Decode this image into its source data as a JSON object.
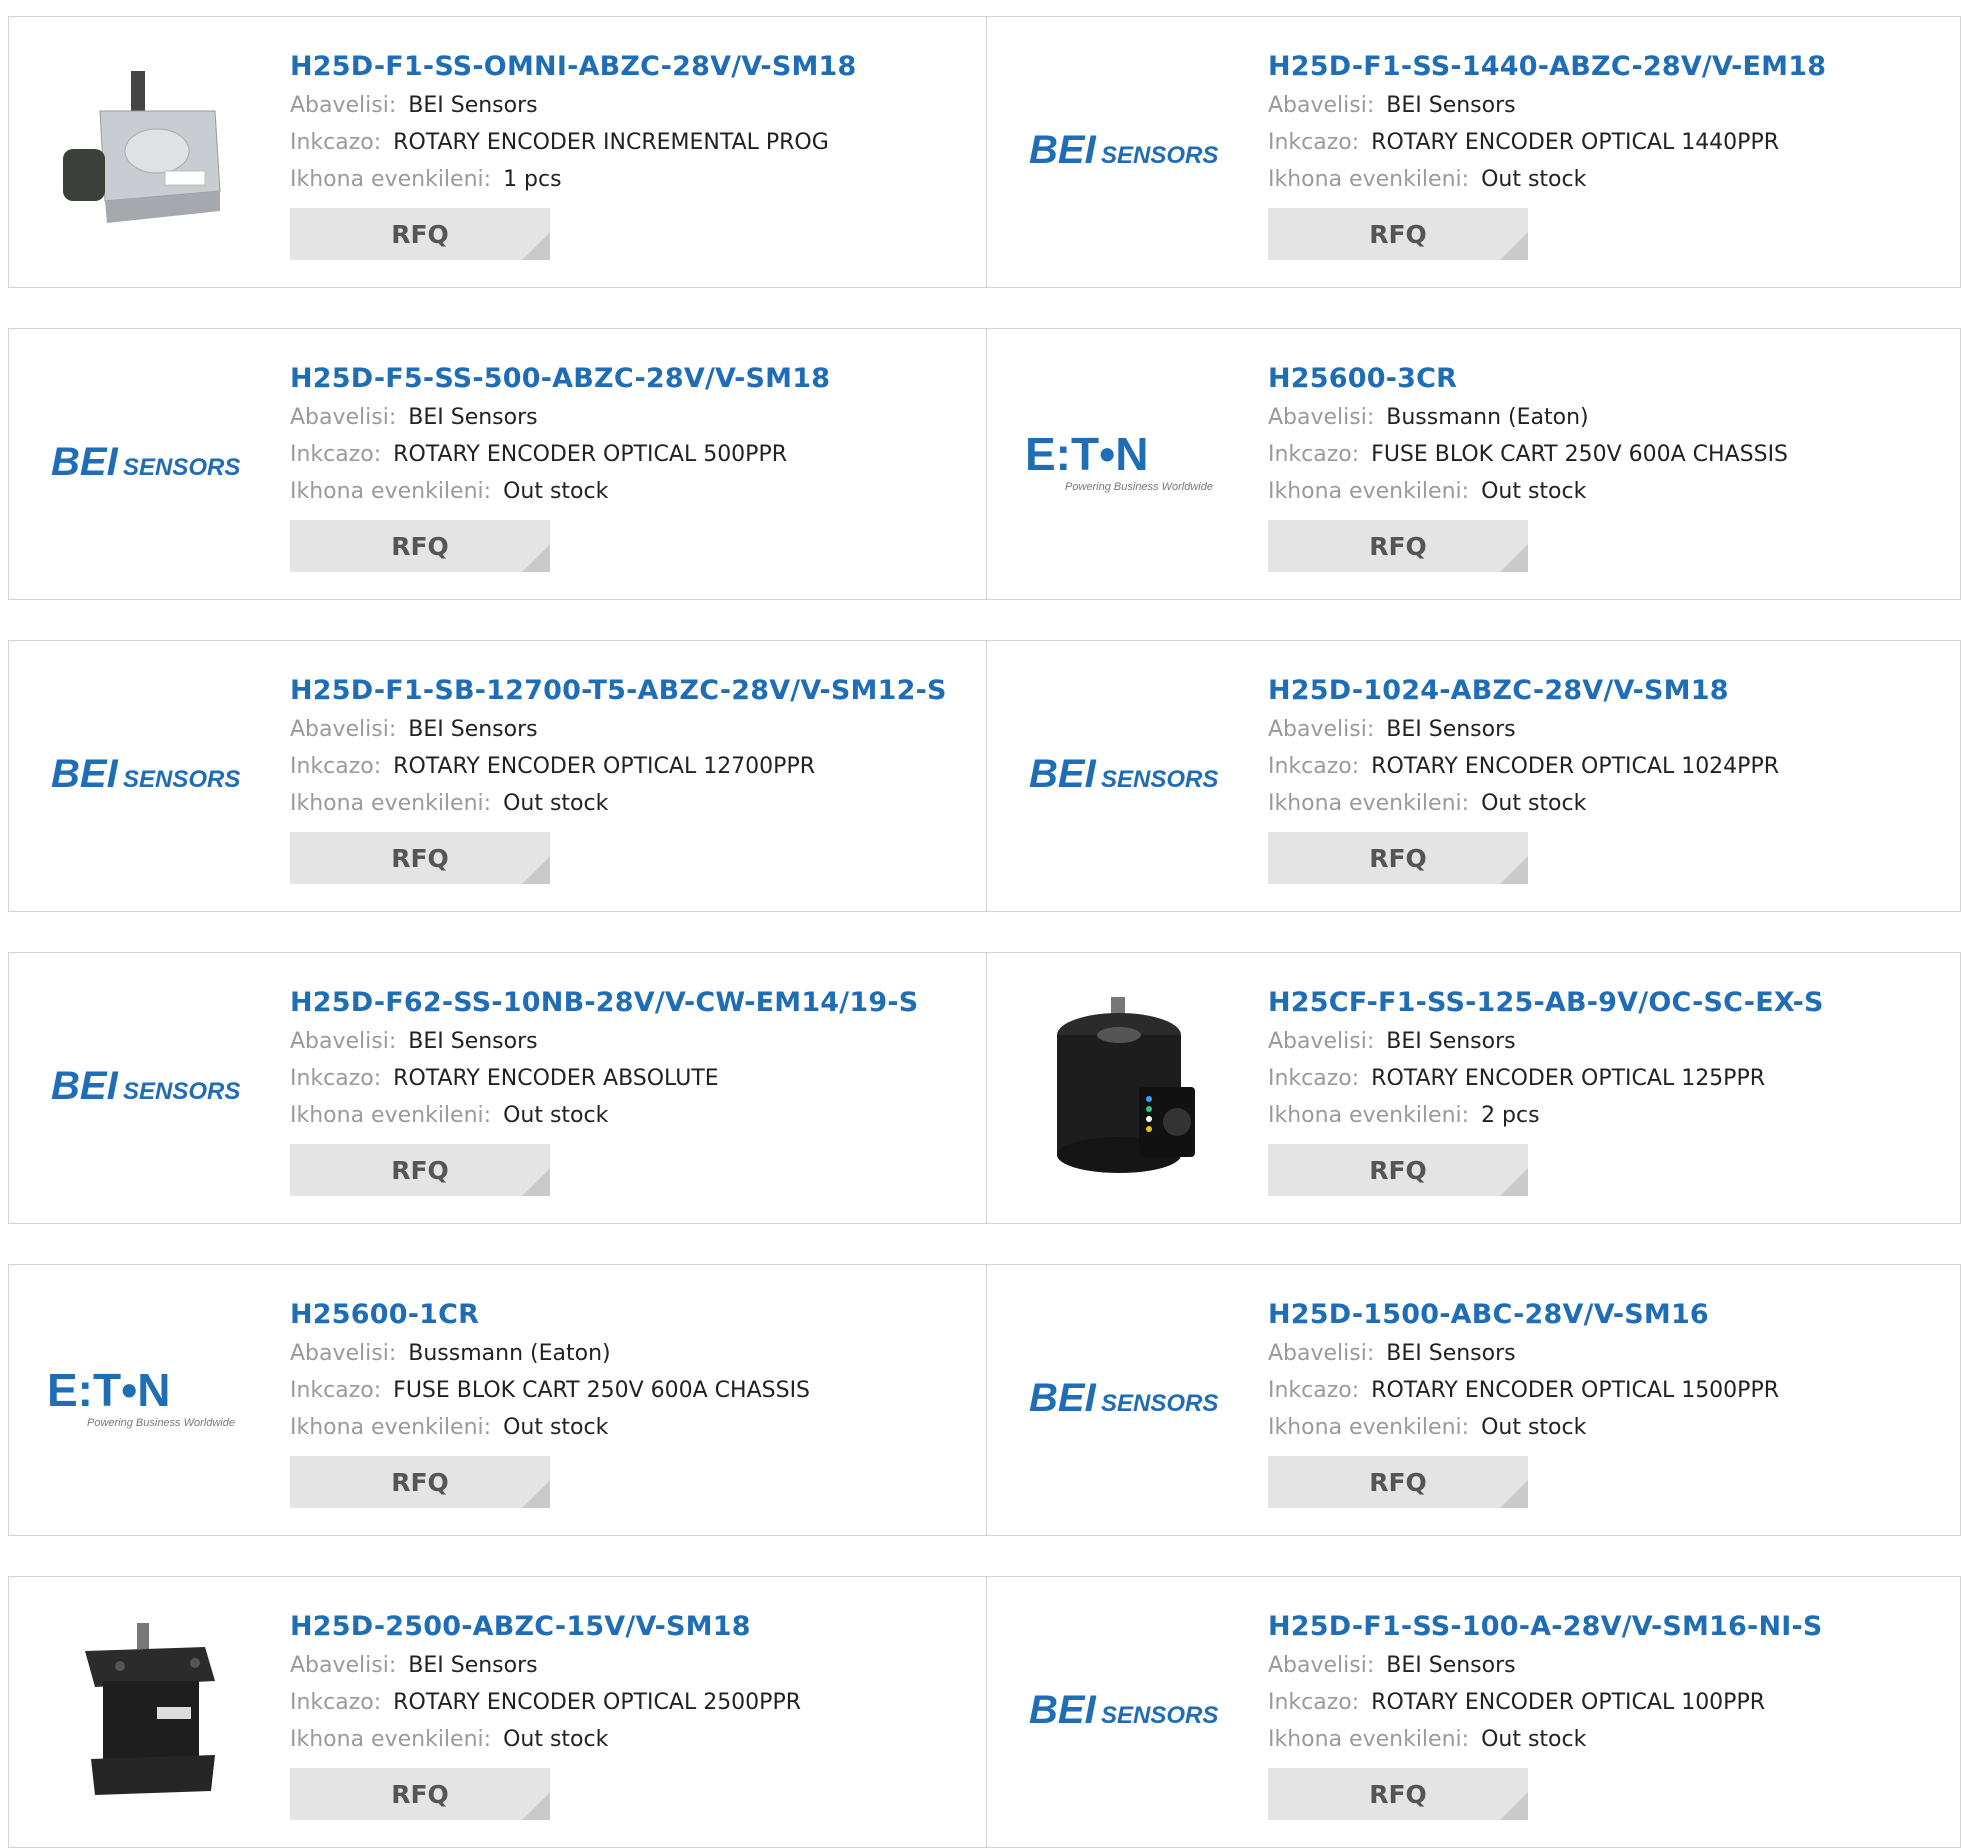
{
  "labels": {
    "manufacturer": "Abavelisi:",
    "description": "Inkcazo:",
    "stock": "Ikhona evenkileni:",
    "rfq": "RFQ"
  },
  "brand_logos": {
    "bei": {
      "strong": "BEI",
      "rest": "SENSORS",
      "color": "#1f6db5"
    },
    "eaton": {
      "word": "E:T•N",
      "tagline": "Powering Business Worldwide",
      "color": "#1f6db5"
    }
  },
  "products": [
    {
      "part": "H25D-F1-SS-OMNI-ABZC-28V/V-SM18",
      "manufacturer": "BEI Sensors",
      "description": "ROTARY ENCODER INCREMENTAL PROG",
      "stock": "1 pcs",
      "image": "encoder-photo-silver"
    },
    {
      "part": "H25D-F1-SS-1440-ABZC-28V/V-EM18",
      "manufacturer": "BEI Sensors",
      "description": "ROTARY ENCODER OPTICAL 1440PPR",
      "stock": "Out stock",
      "image": "bei-logo"
    },
    {
      "part": "H25D-F5-SS-500-ABZC-28V/V-SM18",
      "manufacturer": "BEI Sensors",
      "description": "ROTARY ENCODER OPTICAL 500PPR",
      "stock": "Out stock",
      "image": "bei-logo"
    },
    {
      "part": "H25600-3CR",
      "manufacturer": "Bussmann (Eaton)",
      "description": "FUSE BLOK CART 250V 600A CHASSIS",
      "stock": "Out stock",
      "image": "eaton-logo"
    },
    {
      "part": "H25D-F1-SB-12700-T5-ABZC-28V/V-SM12-S",
      "manufacturer": "BEI Sensors",
      "description": "ROTARY ENCODER OPTICAL 12700PPR",
      "stock": "Out stock",
      "image": "bei-logo"
    },
    {
      "part": "H25D-1024-ABZC-28V/V-SM18",
      "manufacturer": "BEI Sensors",
      "description": "ROTARY ENCODER OPTICAL 1024PPR",
      "stock": "Out stock",
      "image": "bei-logo"
    },
    {
      "part": "H25D-F62-SS-10NB-28V/V-CW-EM14/19-S",
      "manufacturer": "BEI Sensors",
      "description": "ROTARY ENCODER ABSOLUTE",
      "stock": "Out stock",
      "image": "bei-logo"
    },
    {
      "part": "H25CF-F1-SS-125-AB-9V/OC-SC-EX-S",
      "manufacturer": "BEI Sensors",
      "description": "ROTARY ENCODER OPTICAL 125PPR",
      "stock": "2 pcs",
      "image": "encoder-photo-black-cylinder"
    },
    {
      "part": "H25600-1CR",
      "manufacturer": "Bussmann (Eaton)",
      "description": "FUSE BLOK CART 250V 600A CHASSIS",
      "stock": "Out stock",
      "image": "eaton-logo"
    },
    {
      "part": "H25D-1500-ABC-28V/V-SM16",
      "manufacturer": "BEI Sensors",
      "description": "ROTARY ENCODER OPTICAL 1500PPR",
      "stock": "Out stock",
      "image": "bei-logo"
    },
    {
      "part": "H25D-2500-ABZC-15V/V-SM18",
      "manufacturer": "BEI Sensors",
      "description": "ROTARY ENCODER OPTICAL 2500PPR",
      "stock": "Out stock",
      "image": "encoder-photo-black-square"
    },
    {
      "part": "H25D-F1-SS-100-A-28V/V-SM16-NI-S",
      "manufacturer": "BEI Sensors",
      "description": "ROTARY ENCODER OPTICAL 100PPR",
      "stock": "Out stock",
      "image": "bei-logo"
    }
  ]
}
